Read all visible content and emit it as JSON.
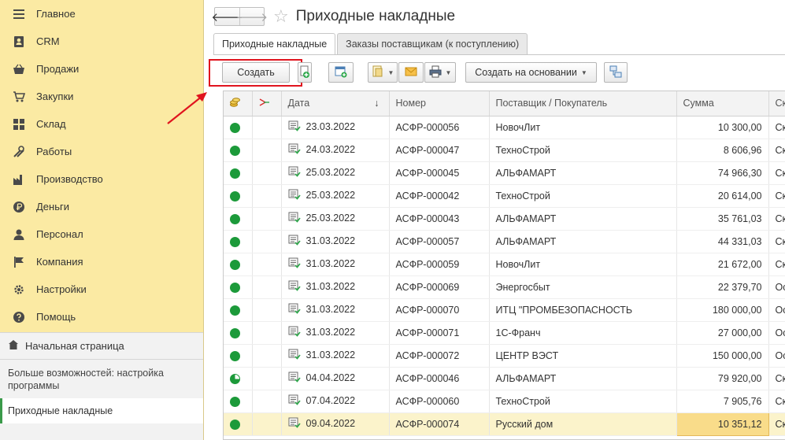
{
  "sidebar": {
    "items": [
      {
        "label": "Главное",
        "icon": "hamburger-icon"
      },
      {
        "label": "CRM",
        "icon": "contacts-icon"
      },
      {
        "label": "Продажи",
        "icon": "basket-icon"
      },
      {
        "label": "Закупки",
        "icon": "cart-icon"
      },
      {
        "label": "Склад",
        "icon": "grid-icon"
      },
      {
        "label": "Работы",
        "icon": "tools-icon"
      },
      {
        "label": "Производство",
        "icon": "factory-icon"
      },
      {
        "label": "Деньги",
        "icon": "ruble-icon"
      },
      {
        "label": "Персонал",
        "icon": "person-icon"
      },
      {
        "label": "Компания",
        "icon": "flag-icon"
      },
      {
        "label": "Настройки",
        "icon": "gear-icon"
      },
      {
        "label": "Помощь",
        "icon": "help-icon"
      }
    ],
    "home_label": "Начальная страница",
    "more_label": "Больше возможностей: настройка программы",
    "current_label": "Приходные накладные"
  },
  "header": {
    "title": "Приходные накладные",
    "back_symbol": "🡐",
    "forward_symbol": "🡒",
    "star_symbol": "☆"
  },
  "tabs": [
    {
      "label": "Приходные накладные"
    },
    {
      "label": "Заказы поставщикам (к поступлению)"
    }
  ],
  "toolbar": {
    "create_label": "Создать",
    "create_based_label": "Создать на основании",
    "caret": "▼"
  },
  "table": {
    "columns": [
      "",
      "",
      "Дата",
      "Номер",
      "Поставщик / Покупатель",
      "Сумма",
      "Ск"
    ],
    "sort_indicator": "↓",
    "rows": [
      {
        "status": "full",
        "date": "23.03.2022",
        "number": "АСФР-000056",
        "partner": "НовочЛит",
        "sum": "10 300,00",
        "extra": "Ск"
      },
      {
        "status": "full",
        "date": "24.03.2022",
        "number": "АСФР-000047",
        "partner": "ТехноСтрой",
        "sum": "8 606,96",
        "extra": "Ск"
      },
      {
        "status": "full",
        "date": "25.03.2022",
        "number": "АСФР-000045",
        "partner": "АЛЬФАМАРТ",
        "sum": "74 966,30",
        "extra": "Ск"
      },
      {
        "status": "full",
        "date": "25.03.2022",
        "number": "АСФР-000042",
        "partner": "ТехноСтрой",
        "sum": "20 614,00",
        "extra": "Ск"
      },
      {
        "status": "full",
        "date": "25.03.2022",
        "number": "АСФР-000043",
        "partner": "АЛЬФАМАРТ",
        "sum": "35 761,03",
        "extra": "Ск"
      },
      {
        "status": "full",
        "date": "31.03.2022",
        "number": "АСФР-000057",
        "partner": "АЛЬФАМАРТ",
        "sum": "44 331,03",
        "extra": "Ск"
      },
      {
        "status": "full",
        "date": "31.03.2022",
        "number": "АСФР-000059",
        "partner": "НовочЛит",
        "sum": "21 672,00",
        "extra": "Ск"
      },
      {
        "status": "full",
        "date": "31.03.2022",
        "number": "АСФР-000069",
        "partner": "Энергосбыт",
        "sum": "22 379,70",
        "extra": "Ос"
      },
      {
        "status": "full",
        "date": "31.03.2022",
        "number": "АСФР-000070",
        "partner": "ИТЦ \"ПРОМБЕЗОПАСНОСТЬ",
        "sum": "180 000,00",
        "extra": "Ос"
      },
      {
        "status": "full",
        "date": "31.03.2022",
        "number": "АСФР-000071",
        "partner": "1С-Франч",
        "sum": "27 000,00",
        "extra": "Ос"
      },
      {
        "status": "full",
        "date": "31.03.2022",
        "number": "АСФР-000072",
        "partner": "ЦЕНТР ВЭСТ",
        "sum": "150 000,00",
        "extra": "Ос"
      },
      {
        "status": "partial",
        "date": "04.04.2022",
        "number": "АСФР-000046",
        "partner": "АЛЬФАМАРТ",
        "sum": "79 920,00",
        "extra": "Ск"
      },
      {
        "status": "full",
        "date": "07.04.2022",
        "number": "АСФР-000060",
        "partner": "ТехноСтрой",
        "sum": "7 905,76",
        "extra": "Ск"
      },
      {
        "status": "full",
        "date": "09.04.2022",
        "number": "АСФР-000074",
        "partner": "Русский дом",
        "sum": "10 351,12",
        "extra": "Ск",
        "selected": true
      }
    ]
  },
  "colors": {
    "sidebar_bg": "#fbeaa3",
    "status_green": "#1c9a3a",
    "highlight_red": "#e0141e",
    "selected_row": "#fbf3cb"
  }
}
